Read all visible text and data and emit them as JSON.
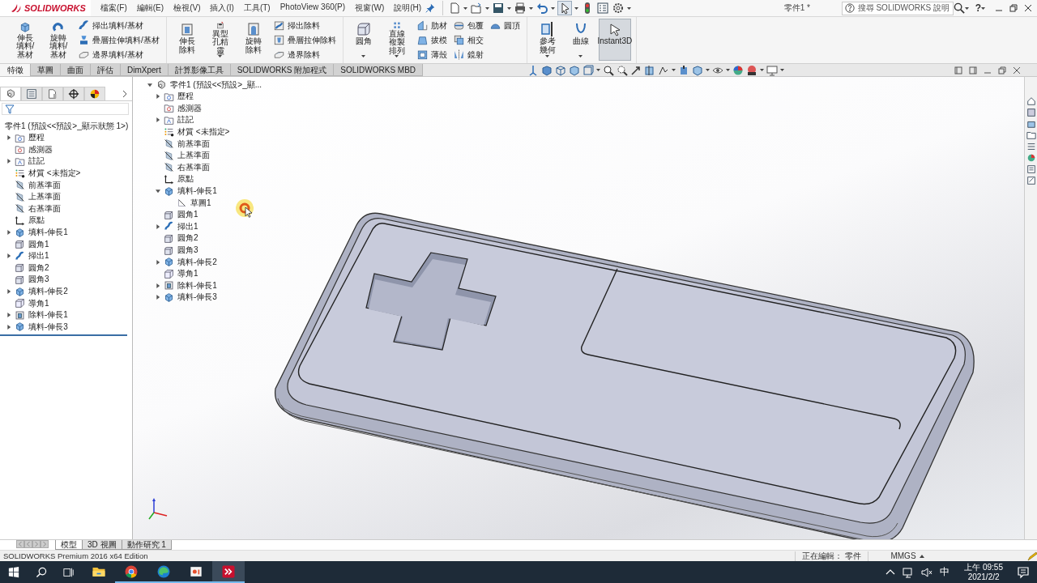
{
  "app": {
    "logo": "SOLIDWORKS"
  },
  "menus": [
    "檔案(F)",
    "編輯(E)",
    "檢視(V)",
    "插入(I)",
    "工具(T)",
    "PhotoView 360(P)",
    "視窗(W)",
    "說明(H)"
  ],
  "window": {
    "title": "零件1 *"
  },
  "search": {
    "placeholder": "搜尋 SOLIDWORKS 說明"
  },
  "help_button": "?",
  "ribbon": {
    "groups": [
      {
        "buttons": [
          {
            "label": "伸長填料/基材",
            "kind": "large",
            "dropdown": false,
            "pressed": false
          },
          {
            "label": "旋轉填料/基材",
            "kind": "large",
            "dropdown": false,
            "pressed": false
          },
          {
            "label": "掃出填料/基材",
            "kind": "small",
            "dropdown": false,
            "pressed": false
          },
          {
            "label": "疊層拉伸填料/基材",
            "kind": "small",
            "dropdown": false,
            "pressed": false
          },
          {
            "label": "邊界填料/基材",
            "kind": "small",
            "dropdown": false,
            "pressed": false
          }
        ]
      },
      {
        "buttons": [
          {
            "label": "伸長除料",
            "kind": "large",
            "dropdown": false,
            "pressed": false
          },
          {
            "label": "異型孔精靈",
            "kind": "large",
            "dropdown": true,
            "pressed": false
          },
          {
            "label": "旋轉除料",
            "kind": "large",
            "dropdown": false,
            "pressed": false
          },
          {
            "label": "掃出除料",
            "kind": "small",
            "dropdown": false,
            "pressed": false
          },
          {
            "label": "疊層拉伸除料",
            "kind": "small",
            "dropdown": false,
            "pressed": false
          },
          {
            "label": "邊界除料",
            "kind": "small",
            "dropdown": false,
            "pressed": false
          }
        ]
      },
      {
        "buttons": [
          {
            "label": "圓角",
            "kind": "large",
            "dropdown": true,
            "pressed": false
          },
          {
            "label": "直線複製排列",
            "kind": "large",
            "dropdown": true,
            "pressed": false
          },
          {
            "label": "肋材",
            "kind": "small",
            "dropdown": false,
            "pressed": false
          },
          {
            "label": "拔模",
            "kind": "small",
            "dropdown": false,
            "pressed": false
          },
          {
            "label": "薄殼",
            "kind": "small",
            "dropdown": false,
            "pressed": false
          },
          {
            "label": "包覆",
            "kind": "small",
            "dropdown": false,
            "pressed": false
          },
          {
            "label": "相交",
            "kind": "small",
            "dropdown": false,
            "pressed": false
          },
          {
            "label": "鏡射",
            "kind": "small",
            "dropdown": false,
            "pressed": false
          },
          {
            "label": "圓頂",
            "kind": "small",
            "dropdown": false,
            "pressed": false
          }
        ]
      },
      {
        "buttons": [
          {
            "label": "參考幾何",
            "kind": "large",
            "dropdown": true,
            "pressed": false
          },
          {
            "label": "曲線",
            "kind": "large",
            "dropdown": true,
            "pressed": false
          },
          {
            "label": "Instant3D",
            "kind": "large",
            "dropdown": false,
            "pressed": true
          }
        ]
      }
    ]
  },
  "command_tabs": [
    {
      "label": "特徵",
      "selected": true
    },
    {
      "label": "草圖",
      "selected": false
    },
    {
      "label": "曲面",
      "selected": false
    },
    {
      "label": "評估",
      "selected": false
    },
    {
      "label": "DimXpert",
      "selected": false
    },
    {
      "label": "計算影像工具",
      "selected": false
    },
    {
      "label": "SOLIDWORKS 附加程式",
      "selected": false
    },
    {
      "label": "SOLIDWORKS MBD",
      "selected": false
    }
  ],
  "panel_tabs": [
    {
      "selected": true
    },
    {
      "selected": false
    },
    {
      "selected": false
    },
    {
      "selected": false
    },
    {
      "selected": false
    }
  ],
  "feature_manager": {
    "root": {
      "label": "零件1 (預設<<預設>_顯示狀態 1>)"
    },
    "items": [
      {
        "label": "歷程",
        "kind": "history",
        "expandable": true,
        "expanded": false
      },
      {
        "label": "感測器",
        "kind": "sensor",
        "expandable": false
      },
      {
        "label": "註記",
        "kind": "annotation",
        "expandable": true,
        "expanded": false
      },
      {
        "label": "材質 <未指定>",
        "kind": "material",
        "expandable": false
      },
      {
        "label": "前基準面",
        "kind": "plane",
        "expandable": false
      },
      {
        "label": "上基準面",
        "kind": "plane",
        "expandable": false
      },
      {
        "label": "右基準面",
        "kind": "plane",
        "expandable": false
      },
      {
        "label": "原點",
        "kind": "origin",
        "expandable": false
      },
      {
        "label": "填料-伸長1",
        "kind": "boss",
        "expandable": true,
        "expanded": false
      },
      {
        "label": "圓角1",
        "kind": "fillet",
        "expandable": false
      },
      {
        "label": "掃出1",
        "kind": "sweep",
        "expandable": true,
        "expanded": false
      },
      {
        "label": "圓角2",
        "kind": "fillet",
        "expandable": false
      },
      {
        "label": "圓角3",
        "kind": "fillet",
        "expandable": false
      },
      {
        "label": "填料-伸長2",
        "kind": "boss",
        "expandable": true,
        "expanded": false
      },
      {
        "label": "導角1",
        "kind": "chamfer",
        "expandable": false
      },
      {
        "label": "除料-伸長1",
        "kind": "cut",
        "expandable": true,
        "expanded": false
      },
      {
        "label": "填料-伸長3",
        "kind": "boss",
        "expandable": true,
        "expanded": false
      }
    ]
  },
  "flyout_tree": {
    "root": {
      "label": "零件1 (預設<<預設>_顯...",
      "expandable": true,
      "expanded": true
    },
    "items": [
      {
        "label": "歷程",
        "kind": "history",
        "expandable": true,
        "expanded": false
      },
      {
        "label": "感測器",
        "kind": "sensor",
        "expandable": false
      },
      {
        "label": "註記",
        "kind": "annotation",
        "expandable": true,
        "expanded": false
      },
      {
        "label": "材質 <未指定>",
        "kind": "material",
        "expandable": false
      },
      {
        "label": "前基準面",
        "kind": "plane",
        "expandable": false
      },
      {
        "label": "上基準面",
        "kind": "plane",
        "expandable": false
      },
      {
        "label": "右基準面",
        "kind": "plane",
        "expandable": false
      },
      {
        "label": "原點",
        "kind": "origin",
        "expandable": false
      },
      {
        "label": "填料-伸長1",
        "kind": "boss",
        "expandable": true,
        "expanded": true,
        "children": [
          {
            "label": "草圖1",
            "kind": "sketch",
            "expandable": false
          }
        ]
      },
      {
        "label": "圓角1",
        "kind": "fillet",
        "expandable": false
      },
      {
        "label": "掃出1",
        "kind": "sweep",
        "expandable": true,
        "expanded": false
      },
      {
        "label": "圓角2",
        "kind": "fillet",
        "expandable": false
      },
      {
        "label": "圓角3",
        "kind": "fillet",
        "expandable": false
      },
      {
        "label": "填料-伸長2",
        "kind": "boss",
        "expandable": true,
        "expanded": false
      },
      {
        "label": "導角1",
        "kind": "chamfer",
        "expandable": false
      },
      {
        "label": "除料-伸長1",
        "kind": "cut",
        "expandable": true,
        "expanded": false
      },
      {
        "label": "填料-伸長3",
        "kind": "boss",
        "expandable": true,
        "expanded": false
      }
    ]
  },
  "bottom_tabs": [
    {
      "label": "模型",
      "selected": true
    },
    {
      "label": "3D 視圖",
      "selected": false
    },
    {
      "label": "動作研究 1",
      "selected": false
    }
  ],
  "status_bar": {
    "edition": "SOLIDWORKS Premium 2016 x64 Edition",
    "editing": "正在編輯： 零件",
    "units": "MMGS"
  },
  "taskbar": {
    "apps": [
      {
        "kind": "explorer",
        "running": false,
        "active": false
      },
      {
        "kind": "chrome",
        "running": true,
        "active": false
      },
      {
        "kind": "edge",
        "running": true,
        "active": false
      },
      {
        "kind": "slides",
        "running": true,
        "active": false
      },
      {
        "kind": "solidworks",
        "running": true,
        "active": true
      }
    ],
    "ime": "中",
    "time": "上午 09:55",
    "date": "2021/2/2"
  }
}
